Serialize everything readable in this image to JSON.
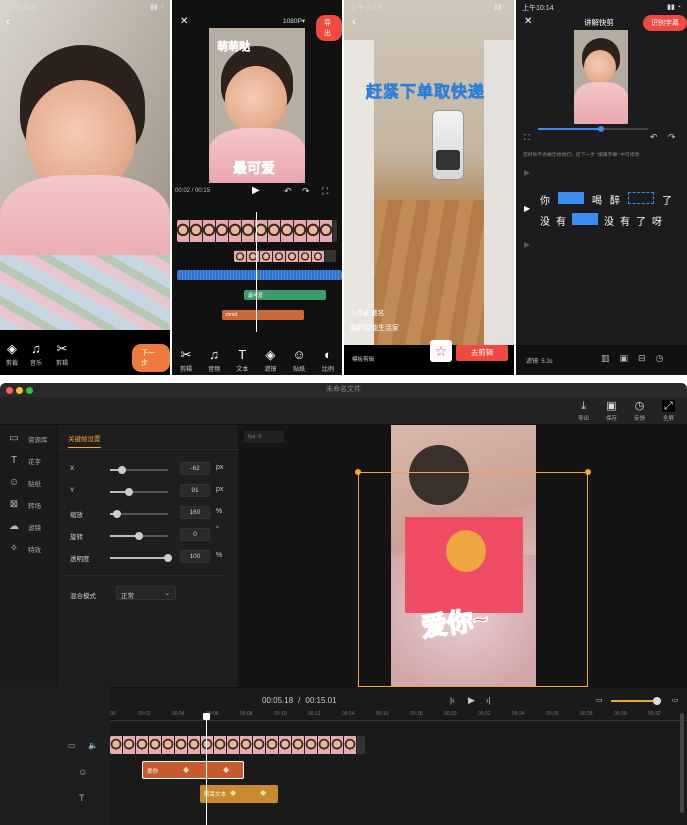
{
  "phone1": {
    "status_time": "上午10:20",
    "next_button": "下一步",
    "tools": [
      {
        "label": "剪裁",
        "icon": "crop-icon"
      },
      {
        "label": "音乐",
        "icon": "music-icon"
      },
      {
        "label": "剪辑",
        "icon": "scissors-icon"
      }
    ]
  },
  "phone2": {
    "resolution": "1080P",
    "export_button": "导出",
    "sticker_text_top": "萌萌哒",
    "sticker_text_bottom": "最可爱",
    "time_readout": "00:02 / 00:15",
    "clip_label_green": "最可爱",
    "clip_label_orange": "mmd",
    "tools": [
      {
        "label": "剪辑",
        "icon": "scissors-icon"
      },
      {
        "label": "音频",
        "icon": "music-icon"
      },
      {
        "label": "文本",
        "icon": "text-icon"
      },
      {
        "label": "滤镜",
        "icon": "filter-icon"
      },
      {
        "label": "贴纸",
        "icon": "sticker-icon"
      },
      {
        "label": "比例",
        "icon": "ratio-icon"
      }
    ]
  },
  "phone3": {
    "status_time": "上午10:17",
    "overlay_text": "赶紧下单取快递",
    "uploader": "上传者:匿名",
    "caption": "我的智能生活家",
    "template_label": "模板剪辑",
    "edit_button": "去剪辑"
  },
  "phone4": {
    "status_time": "上午10:14",
    "title": "讲解快剪",
    "recognize_button": "识别字幕",
    "hint": "您好你不会展示给他们，后下一步 \"编辑字幕\" 中可修改",
    "line1": [
      "你",
      "喝",
      "醉",
      "了"
    ],
    "line2": [
      "没",
      "有",
      "没",
      "有",
      "了",
      "呀"
    ],
    "bottom_label": "滤镜: 5.3s"
  },
  "desktop": {
    "window_title": "未命名文件",
    "toolbar": [
      {
        "label": "导出",
        "icon": "download-icon"
      },
      {
        "label": "保存",
        "icon": "save-icon"
      },
      {
        "label": "反馈",
        "icon": "feedback-icon"
      },
      {
        "label": "全屏",
        "icon": "fullscreen-icon"
      }
    ],
    "sidebar": [
      {
        "label": "资源库",
        "icon": "folder-icon"
      },
      {
        "label": "花字",
        "icon": "text-icon"
      },
      {
        "label": "贴纸",
        "icon": "sticker-icon"
      },
      {
        "label": "转场",
        "icon": "transition-icon"
      },
      {
        "label": "滤镜",
        "icon": "filter-icon"
      },
      {
        "label": "特效",
        "icon": "effects-icon"
      }
    ],
    "panel_tab": "关键帧设置",
    "preview_badge": "fps: 0",
    "props": [
      {
        "label": "X",
        "value": "-62",
        "unit": "px",
        "level": 0.2
      },
      {
        "label": "Y",
        "value": "91",
        "unit": "px",
        "level": 0.33
      },
      {
        "label": "缩放",
        "value": "160",
        "unit": "%",
        "level": 0.12
      },
      {
        "label": "旋转",
        "value": "0",
        "unit": "°",
        "level": 0.5
      },
      {
        "label": "透明度",
        "value": "100",
        "unit": "%",
        "level": 1.0
      }
    ],
    "blend_label": "混合模式",
    "blend_value": "正常",
    "sticker_text": "爱你~",
    "time_current": "00:05.18",
    "time_separator": "/",
    "time_total": "00:15.01",
    "ticks": [
      "00",
      "00:02",
      "00:04",
      "00:06",
      "00:08",
      "00:10",
      "00:12",
      "00:14",
      "00:16",
      "00:18",
      "00:20",
      "00:22",
      "00:24",
      "00:26",
      "00:28",
      "00:30",
      "00:32"
    ],
    "sticker_clip_label": "爱你",
    "text_clip_label": "阿呆文本",
    "colors": {
      "accent": "#f0a640",
      "sticker_clip": "#c65a2e",
      "text_clip": "#c98a2e"
    }
  }
}
